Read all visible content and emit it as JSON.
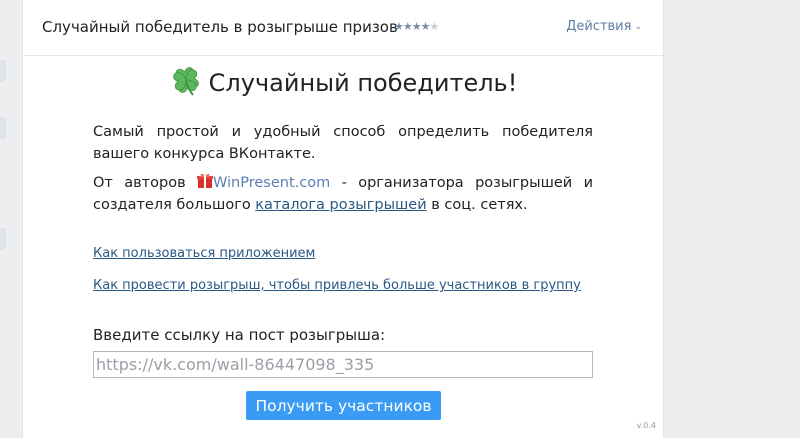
{
  "header": {
    "title": "Случайный победитель в розыгрыше призов",
    "rating_filled": "★★★★",
    "rating_empty": "★",
    "actions_label": "Действия",
    "actions_chevron": "⌄"
  },
  "app": {
    "title": "Случайный победитель!",
    "description_1": "Самый простой и удобный способ определить победителя вашего конкурса ВКонтакте.",
    "description_2_before": "От авторов ",
    "brand_name": "WinPresent.com",
    "description_2_middle": " - организатора розыгрышей и создателя большого ",
    "catalog_link": "каталога розыгрышей",
    "description_2_after": " в соц. сетях.",
    "help_link_1": "Как пользоваться приложением",
    "help_link_2": "Как провести розыгрыш, чтобы привлечь больше участников в группу",
    "input_label": "Введите ссылку на пост розыгрыша:",
    "input_placeholder": "https://vk.com/wall-86447098_335",
    "input_value": "",
    "submit_label": "Получить участников",
    "version": "v.0.4"
  },
  "colors": {
    "accent": "#3a9bf4",
    "link": "#2a5885",
    "background": "#edeef0",
    "clover": "#5cb85c"
  },
  "icons": {
    "clover": "four-leaf-clover-icon",
    "gift": "gift-icon",
    "chevron": "chevron-down-icon",
    "rating": "star-icon"
  }
}
